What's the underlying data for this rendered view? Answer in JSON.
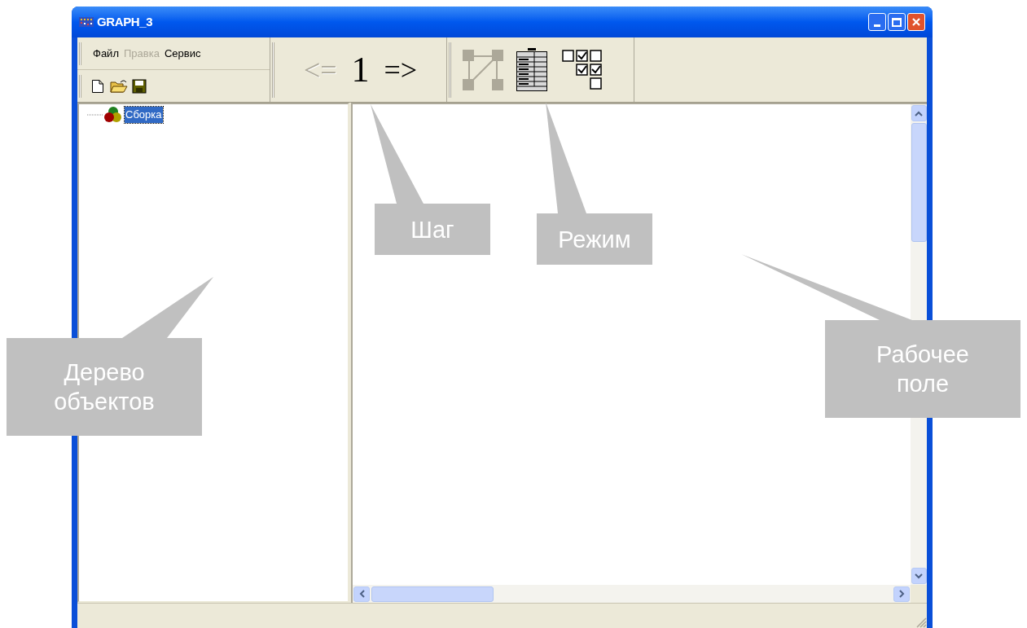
{
  "window": {
    "title": "GRAPH_3"
  },
  "menu": [
    {
      "label": "Файл",
      "disabled": false
    },
    {
      "label": "Правка",
      "disabled": true
    },
    {
      "label": "Сервис",
      "disabled": false
    }
  ],
  "step": {
    "prev": {
      "label": "<=",
      "disabled": true
    },
    "value": "1",
    "next": {
      "label": "=>",
      "disabled": false
    }
  },
  "tree": [
    {
      "label": "Сборка",
      "selected": true
    }
  ],
  "callouts": [
    {
      "text": "Шаг"
    },
    {
      "text": "Режим"
    },
    {
      "text": "Дерево объектов"
    },
    {
      "text": "Рабочее поле"
    }
  ]
}
